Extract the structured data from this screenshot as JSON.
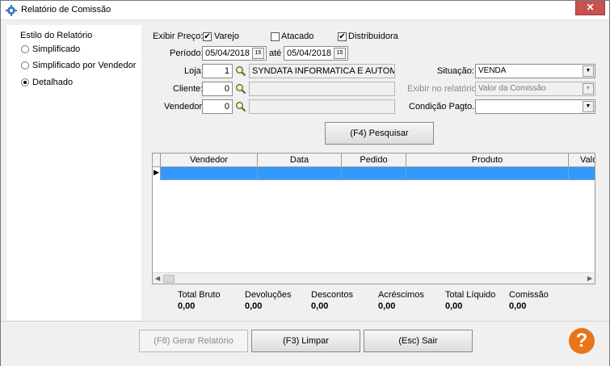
{
  "window": {
    "title": "Relatório de Comissão",
    "close_glyph": "✕"
  },
  "style_panel": {
    "heading": "Estilo do Relatório",
    "options": [
      {
        "label": "Simplificado",
        "checked": false
      },
      {
        "label": "Simplificado por Vendedor",
        "checked": false
      },
      {
        "label": "Detalhado",
        "checked": true
      }
    ]
  },
  "price": {
    "label": "Exibir Preço:",
    "varejo": "Varejo",
    "atacado": "Atacado",
    "distribuidora": "Distribuidora",
    "varejo_checked": true,
    "atacado_checked": false,
    "distribuidora_checked": true
  },
  "period": {
    "label": "Período:",
    "start": "05/04/2018",
    "to_label": "até",
    "end": "05/04/2018",
    "cal_glyph": "15"
  },
  "store": {
    "label": "Loja:",
    "code": "1",
    "name": "SYNDATA INFORMATICA E AUTOMAC"
  },
  "client": {
    "label": "Cliente:",
    "code": "0",
    "name": ""
  },
  "seller": {
    "label": "Vendedor:",
    "code": "0",
    "name": ""
  },
  "situation": {
    "label": "Situação:",
    "value": "VENDA"
  },
  "display": {
    "label": "Exibir no relatório:",
    "value": "Valor da Comissão"
  },
  "payment": {
    "label": "Condição Pagto.:",
    "value": ""
  },
  "search_button": "(F4) Pesquisar",
  "grid": {
    "columns": [
      "Vendedor",
      "Data",
      "Pedido",
      "Produto",
      "Valo"
    ],
    "row_marker": "▶"
  },
  "totals": [
    {
      "label": "Total Bruto",
      "value": "0,00"
    },
    {
      "label": "Devoluções",
      "value": "0,00"
    },
    {
      "label": "Descontos",
      "value": "0,00"
    },
    {
      "label": "Acréscimos",
      "value": "0,00"
    },
    {
      "label": "Total Líquido",
      "value": "0,00"
    },
    {
      "label": "Comissão",
      "value": "0,00"
    }
  ],
  "footer": {
    "generate": "(F8) Gerar Relatório",
    "clear": "(F3) Limpar",
    "exit": "(Esc) Sair",
    "help": "?"
  },
  "colors": {
    "selected_row": "#3399ff",
    "help": "#e8751a",
    "close": "#c75050"
  },
  "icons": {
    "app": "gear-icon",
    "lookup": "search-icon",
    "calendar": "calendar-icon",
    "combo": "chevron-down-icon"
  }
}
